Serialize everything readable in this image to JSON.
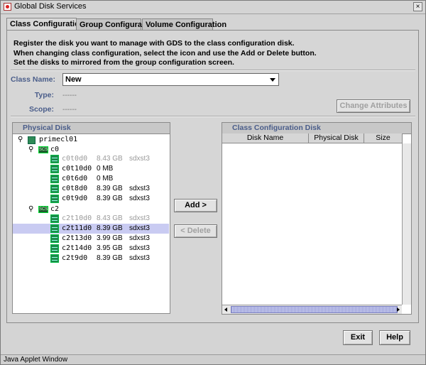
{
  "window": {
    "title": "Global Disk Services",
    "close_glyph": "×"
  },
  "tabs": [
    {
      "label": "Class Configuration",
      "active": true
    },
    {
      "label": "Group Configuration",
      "active": false
    },
    {
      "label": "Volume Configuration",
      "active": false
    }
  ],
  "instructions": [
    "Register the disk you want to manage with GDS to the class configuration disk.",
    "When changing class configuration, select the icon and use the Add or Delete button.",
    "Set the disks to mirrored from the group configuration screen."
  ],
  "class_form": {
    "name_label": "Class Name:",
    "name_value": "New",
    "type_label": "Type:",
    "type_value": "------",
    "scope_label": "Scope:",
    "scope_value": "------",
    "change_attributes_label": "Change Attributes"
  },
  "physical_disk": {
    "header": "Physical Disk",
    "key_glyph": "⚲",
    "server": "primecl01",
    "controllers": [
      {
        "name": "c0",
        "icon_text": "SCSI",
        "disks": [
          {
            "name": "c0t0d0",
            "size": "8.43 GB",
            "class": "sdxst3",
            "dim": true,
            "selected": false
          },
          {
            "name": "c0t10d0",
            "size": "0 MB",
            "class": "",
            "dim": false,
            "selected": false
          },
          {
            "name": "c0t6d0",
            "size": "0 MB",
            "class": "",
            "dim": false,
            "selected": false
          },
          {
            "name": "c0t8d0",
            "size": "8.39 GB",
            "class": "sdxst3",
            "dim": false,
            "selected": false
          },
          {
            "name": "c0t9d0",
            "size": "8.39 GB",
            "class": "sdxst3",
            "dim": false,
            "selected": false
          }
        ]
      },
      {
        "name": "c2",
        "icon_text": "SCSI",
        "disks": [
          {
            "name": "c2t10d0",
            "size": "8.43 GB",
            "class": "sdxst3",
            "dim": true,
            "selected": false
          },
          {
            "name": "c2t11d0",
            "size": "8.39 GB",
            "class": "sdxst3",
            "dim": false,
            "selected": true
          },
          {
            "name": "c2t13d0",
            "size": "3.99 GB",
            "class": "sdxst3",
            "dim": false,
            "selected": false
          },
          {
            "name": "c2t14d0",
            "size": "3.95 GB",
            "class": "sdxst3",
            "dim": false,
            "selected": false
          },
          {
            "name": "c2t9d0",
            "size": "8.39 GB",
            "class": "sdxst3",
            "dim": false,
            "selected": false
          }
        ]
      }
    ]
  },
  "actions": {
    "add_label": "Add >",
    "delete_label": "< Delete"
  },
  "class_config_disk": {
    "header": "Class Configuration Disk",
    "columns": [
      "Disk Name",
      "Physical Disk",
      "Size"
    ]
  },
  "footer": {
    "exit_label": "Exit",
    "help_label": "Help"
  },
  "status_bar": {
    "text": "Java Applet Window"
  }
}
